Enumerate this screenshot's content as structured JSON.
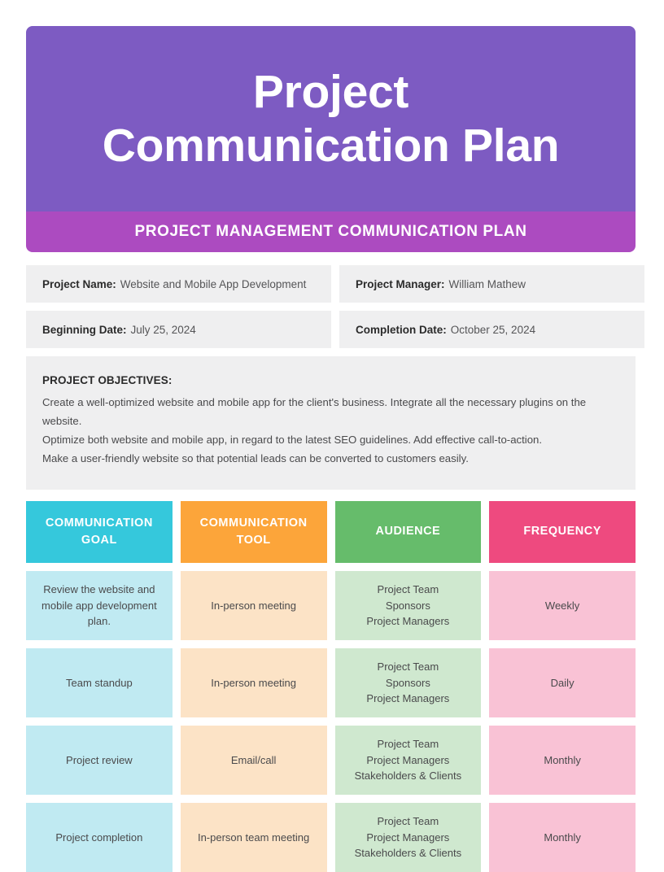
{
  "header": {
    "title": "Project Communication Plan",
    "banner": "PROJECT MANAGEMENT COMMUNICATION PLAN",
    "title_bg": "#7d5bc2",
    "banner_bg": "#ac4bc0"
  },
  "info_fields": [
    {
      "label": "Project Name:",
      "value": "Website and Mobile App Development"
    },
    {
      "label": "Project Manager:",
      "value": "William Mathew"
    },
    {
      "label": "Beginning Date:",
      "value": "July 25, 2024"
    },
    {
      "label": "Completion Date:",
      "value": "October 25, 2024"
    }
  ],
  "objectives": {
    "title": "PROJECT OBJECTIVES:",
    "lines": [
      "Create a well-optimized website and mobile app for the client's business. Integrate all the necessary plugins on the website.",
      "Optimize both website and mobile app, in regard to the latest SEO guidelines. Add effective call-to-action.",
      "Make a user-friendly website so that potential leads can be converted to customers easily."
    ]
  },
  "table": {
    "headers": [
      {
        "label": "COMMUNICATION GOAL",
        "bg": "#35c8dc"
      },
      {
        "label": "COMMUNICATION TOOL",
        "bg": "#fca53a"
      },
      {
        "label": "AUDIENCE",
        "bg": "#66bc6b"
      },
      {
        "label": "FREQUENCY",
        "bg": "#ee4a7f"
      }
    ],
    "column_body_bg": [
      "#c0eaf2",
      "#fce3c6",
      "#cfe8cf",
      "#f9c2d5"
    ],
    "rows": [
      {
        "goal": "Review the website and mobile app development plan.",
        "tool": "In-person meeting",
        "audience": "Project Team\nSponsors\nProject Managers",
        "frequency": "Weekly"
      },
      {
        "goal": "Team standup",
        "tool": "In-person meeting",
        "audience": "Project Team\nSponsors\nProject Managers",
        "frequency": "Daily"
      },
      {
        "goal": "Project review",
        "tool": "Email/call",
        "audience": "Project Team\nProject Managers\nStakeholders & Clients",
        "frequency": "Monthly"
      },
      {
        "goal": "Project completion",
        "tool": "In-person team meeting",
        "audience": "Project Team\nProject Managers\nStakeholders & Clients",
        "frequency": "Monthly"
      }
    ]
  }
}
